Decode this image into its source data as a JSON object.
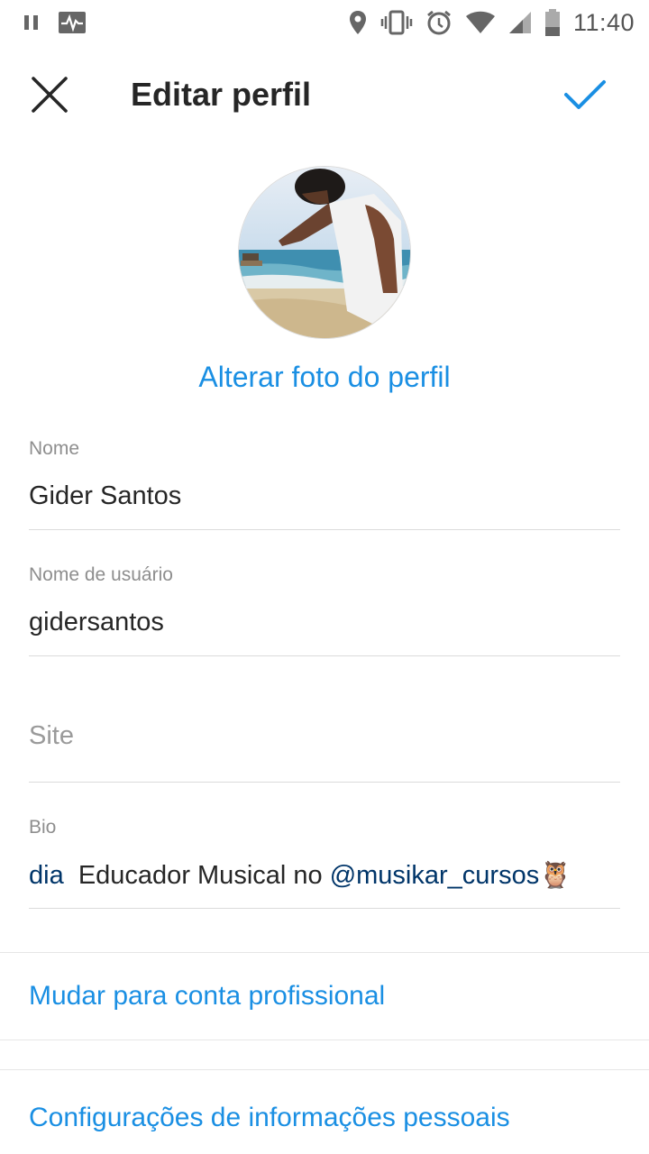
{
  "status_bar": {
    "time": "11:40",
    "icons": [
      "pause-icon",
      "activity-icon",
      "location-icon",
      "vibrate-icon",
      "alarm-icon",
      "wifi-icon",
      "signal-icon",
      "battery-icon"
    ]
  },
  "header": {
    "title": "Editar perfil",
    "close_icon": "close-icon",
    "done_icon": "checkmark-icon"
  },
  "profile": {
    "change_photo_label": "Alterar foto do perfil"
  },
  "fields": {
    "name": {
      "label": "Nome",
      "value": "Gider Santos"
    },
    "username": {
      "label": "Nome de usuário",
      "value": "gidersantos"
    },
    "site": {
      "placeholder": "Site",
      "value": ""
    },
    "bio": {
      "label": "Bio",
      "prefix": "dia",
      "text": "Educador Musical no ",
      "mention": "@musikar_cursos",
      "emoji": "🦉"
    }
  },
  "links": {
    "professional": "Mudar para conta profissional",
    "personal_info": "Configurações de informações pessoais"
  },
  "colors": {
    "accent": "#1a8fe3",
    "text": "#262626",
    "muted": "#8e8e8e",
    "divider": "#dbdbdb",
    "mention": "#003569"
  }
}
